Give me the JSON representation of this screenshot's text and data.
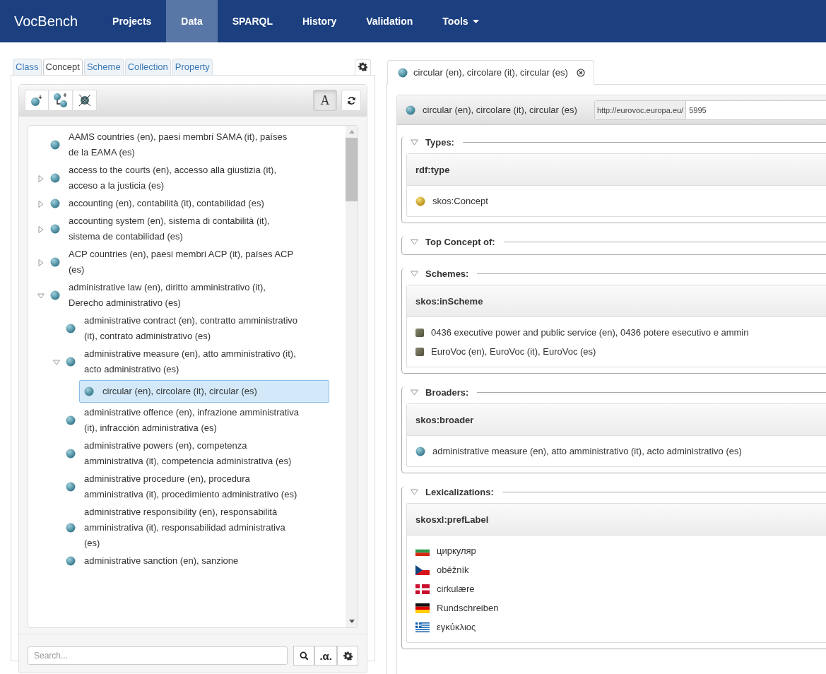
{
  "navbar": {
    "brand": "VocBench",
    "items": [
      {
        "label": "Projects",
        "selected": false,
        "dropdown": false
      },
      {
        "label": "Data",
        "selected": true,
        "dropdown": false
      },
      {
        "label": "SPARQL",
        "selected": false,
        "dropdown": false
      },
      {
        "label": "History",
        "selected": false,
        "dropdown": false
      },
      {
        "label": "Validation",
        "selected": false,
        "dropdown": false
      },
      {
        "label": "Tools",
        "selected": false,
        "dropdown": true
      }
    ]
  },
  "left_panel": {
    "tabs": [
      {
        "label": "Class",
        "selected": false
      },
      {
        "label": "Concept",
        "selected": true
      },
      {
        "label": "Scheme",
        "selected": false
      },
      {
        "label": "Collection",
        "selected": false
      },
      {
        "label": "Property",
        "selected": false
      }
    ],
    "lang_toggle": {
      "label": "A",
      "on": true
    },
    "tree": [
      {
        "label": "AAMS countries (en), paesi membri SAMA (it), países de la EAMA (es)",
        "selected": false
      },
      {
        "label": "access to the courts (en), accesso alla giustizia (it), acceso a la justicia (es)",
        "expanded": false,
        "selected": false
      },
      {
        "label": "accounting (en), contabilità (it), contabilidad (es)",
        "expanded": false,
        "selected": false
      },
      {
        "label": "accounting system (en), sistema di contabilità (it), sistema de contabilidad (es)",
        "expanded": false,
        "selected": false
      },
      {
        "label": "ACP countries (en), paesi membri ACP (it), países ACP (es)",
        "expanded": false,
        "selected": false
      },
      {
        "label": "administrative law (en), diritto amministrativo (it), Derecho administrativo (es)",
        "expanded": true,
        "selected": false,
        "children": [
          {
            "label": "administrative contract (en), contratto amministrativo (it), contrato administrativo (es)",
            "selected": false
          },
          {
            "label": "administrative measure (en), atto amministrativo (it), acto administrativo (es)",
            "expanded": true,
            "selected": false,
            "children": [
              {
                "label": "circular (en), circolare (it), circular (es)",
                "selected": true
              }
            ]
          },
          {
            "label": "administrative offence (en), infrazione amministrativa (it), infracción administrativa (es)",
            "selected": false
          },
          {
            "label": "administrative powers (en), competenza amministrativa (it), competencia administrativa (es)",
            "selected": false
          },
          {
            "label": "administrative procedure (en), procedura amministrativa (it), procedimiento administrativo (es)",
            "selected": false
          },
          {
            "label": "administrative responsibility (en), responsabilità amministrativa (it), responsabilidad administrativa (es)",
            "selected": false
          },
          {
            "label": "administrative sanction (en), sanzione",
            "selected": false
          }
        ]
      }
    ],
    "search": {
      "placeholder": "Search...",
      "alpha_button": ".α."
    }
  },
  "right_panel": {
    "tab": {
      "label": "circular (en), circolare (it), circular (es)"
    },
    "header": {
      "title": "circular (en), circolare (it), circular (es)",
      "namespace": "http://eurovoc.europa.eu/",
      "local_name": "5995"
    },
    "sections": [
      {
        "title": "Types:",
        "expanded": true,
        "predicate": "rdf:type",
        "values": [
          {
            "kind": "class",
            "label": "skos:Concept"
          }
        ]
      },
      {
        "title": "Top Concept of:",
        "expanded": true
      },
      {
        "title": "Schemes:",
        "expanded": true,
        "predicate": "skos:inScheme",
        "values": [
          {
            "kind": "scheme",
            "label": "0436 executive power and public service (en), 0436 potere esecutivo e ammin"
          },
          {
            "kind": "scheme",
            "label": "EuroVoc (en), EuroVoc (it), EuroVoc (es)"
          }
        ]
      },
      {
        "title": "Broaders:",
        "expanded": true,
        "predicate": "skos:broader",
        "values": [
          {
            "kind": "concept",
            "label": "administrative measure (en), atto amministrativo (it), acto administrativo (es)"
          }
        ]
      },
      {
        "title": "Lexicalizations:",
        "expanded": true,
        "predicate": "skosxl:prefLabel",
        "values": [
          {
            "kind": "bg",
            "label": "циркуляр"
          },
          {
            "kind": "cs",
            "label": "oběžník"
          },
          {
            "kind": "da",
            "label": "cirkulære"
          },
          {
            "kind": "de",
            "label": "Rundschreiben"
          },
          {
            "kind": "el",
            "label": "εγκύκλιος"
          }
        ]
      }
    ]
  }
}
